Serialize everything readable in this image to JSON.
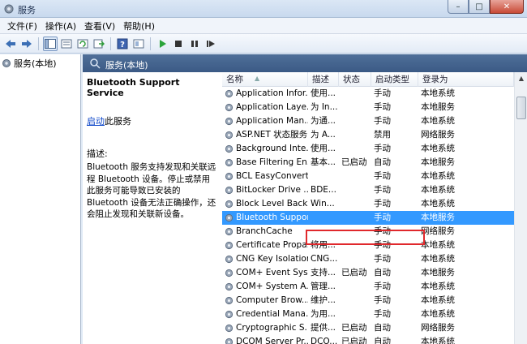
{
  "window": {
    "title": "服务",
    "minimize": "–",
    "maximize": "□",
    "close": "✕"
  },
  "menu": [
    "文件(F)",
    "操作(A)",
    "查看(V)",
    "帮助(H)"
  ],
  "toolbar_icons": [
    "back-icon",
    "forward-icon",
    "console-tree-icon",
    "properties-icon",
    "refresh-icon",
    "export-icon",
    "help-icon",
    "view-icon",
    "start-icon",
    "stop-icon",
    "pause-icon",
    "restart-icon"
  ],
  "tree": {
    "root_label": "服务(本地)"
  },
  "tab": {
    "label": "服务(本地)"
  },
  "details": {
    "service_name": "Bluetooth Support Service",
    "start_link": "启动",
    "start_suffix": "此服务",
    "desc_label": "描述:",
    "desc_text": "Bluetooth 服务支持发现和关联远程 Bluetooth 设备。停止或禁用此服务可能导致已安装的 Bluetooth 设备无法正确操作，还会阻止发现和关联新设备。"
  },
  "columns": [
    "名称",
    "描述",
    "状态",
    "启动类型",
    "登录为"
  ],
  "rows": [
    {
      "name": "Application Infor...",
      "desc": "使用...",
      "status": "",
      "start": "手动",
      "login": "本地系统"
    },
    {
      "name": "Application Laye...",
      "desc": "为 In...",
      "status": "",
      "start": "手动",
      "login": "本地服务"
    },
    {
      "name": "Application Man...",
      "desc": "为通...",
      "status": "",
      "start": "手动",
      "login": "本地系统"
    },
    {
      "name": "ASP.NET 状态服务",
      "desc": "为 A...",
      "status": "",
      "start": "禁用",
      "login": "网络服务"
    },
    {
      "name": "Background Inte...",
      "desc": "使用...",
      "status": "",
      "start": "手动",
      "login": "本地系统"
    },
    {
      "name": "Base Filtering En...",
      "desc": "基本...",
      "status": "已启动",
      "start": "自动",
      "login": "本地服务"
    },
    {
      "name": "BCL EasyConvert...",
      "desc": "",
      "status": "",
      "start": "手动",
      "login": "本地系统"
    },
    {
      "name": "BitLocker Drive ...",
      "desc": "BDE...",
      "status": "",
      "start": "手动",
      "login": "本地系统"
    },
    {
      "name": "Block Level Back...",
      "desc": "Win...",
      "status": "",
      "start": "手动",
      "login": "本地系统"
    },
    {
      "name": "Bluetooth Support Service",
      "desc": "",
      "status": "",
      "start": "手动",
      "login": "本地服务",
      "selected": true
    },
    {
      "name": "BranchCache",
      "desc": "",
      "status": "",
      "start": "手动",
      "login": "网络服务"
    },
    {
      "name": "Certificate Propa...",
      "desc": "将用...",
      "status": "",
      "start": "手动",
      "login": "本地系统"
    },
    {
      "name": "CNG Key Isolation",
      "desc": "CNG...",
      "status": "",
      "start": "手动",
      "login": "本地系统"
    },
    {
      "name": "COM+ Event Sys...",
      "desc": "支持...",
      "status": "已启动",
      "start": "自动",
      "login": "本地服务"
    },
    {
      "name": "COM+ System A...",
      "desc": "管理...",
      "status": "",
      "start": "手动",
      "login": "本地系统"
    },
    {
      "name": "Computer Brow...",
      "desc": "维护...",
      "status": "",
      "start": "手动",
      "login": "本地系统"
    },
    {
      "name": "Credential Mana...",
      "desc": "为用...",
      "status": "",
      "start": "手动",
      "login": "本地系统"
    },
    {
      "name": "Cryptographic S...",
      "desc": "提供...",
      "status": "已启动",
      "start": "自动",
      "login": "网络服务"
    },
    {
      "name": "DCOM Server Pr...",
      "desc": "DCO...",
      "status": "已启动",
      "start": "自动",
      "login": "本地系统"
    }
  ],
  "colors": {
    "selected": "#3399ff",
    "highlight_border": "#e0282c",
    "header": "#3b5a85"
  }
}
